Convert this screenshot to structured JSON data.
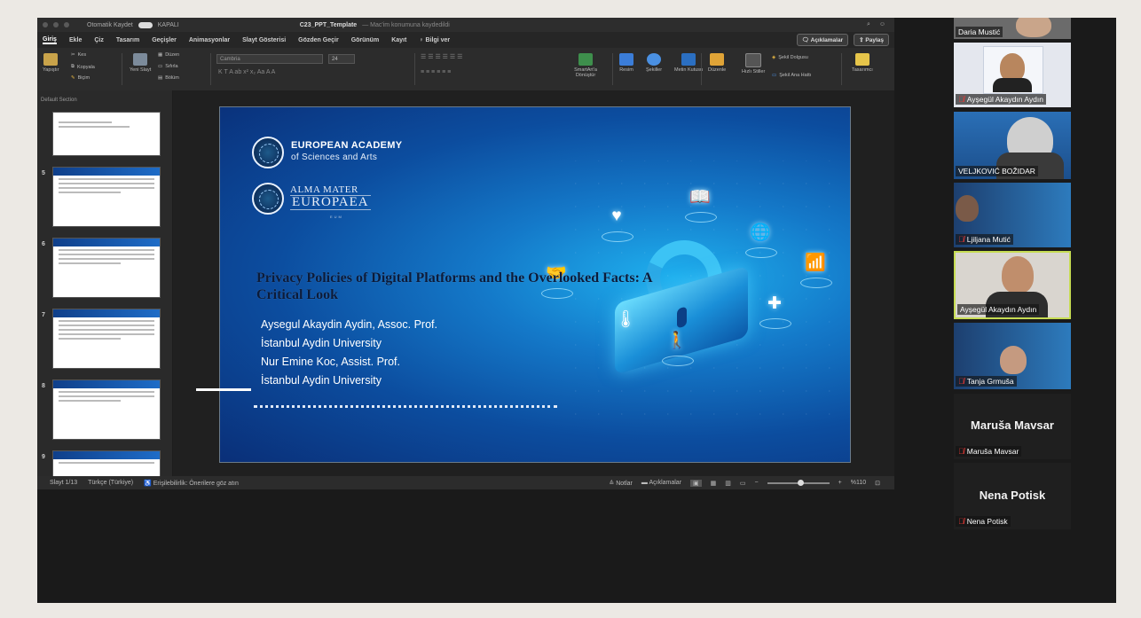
{
  "titlebar": {
    "autosave_label": "Otomatik Kaydet",
    "autosave_state": "KAPALI",
    "doc_title": "C23_PPT_Template",
    "doc_subtitle": "— Mac'im konumuna kaydedildi",
    "right_icons": "⌕ ☺"
  },
  "menu": {
    "tabs": [
      "Giriş",
      "Ekle",
      "Çiz",
      "Tasarım",
      "Geçişler",
      "Animasyonlar",
      "Slayt Gösterisi",
      "Gözden Geçir",
      "Görünüm",
      "Kayıt",
      "♀ Bilgi ver"
    ],
    "comments_button": "Açıklamalar",
    "share_button": "Paylaş"
  },
  "ribbon": {
    "paste": "Yapıştır",
    "cut": "Kes",
    "copy": "Kopyala",
    "format": "Biçim",
    "new_slide": "Yeni Slayt",
    "layout": "Düzen",
    "reset": "Sıfırla",
    "section": "Bölüm",
    "font_name": "Cambria",
    "font_size": "24",
    "format_row": "K  T  A  ab  x²  x₂  Aa  A  A",
    "smartart": "SmartArt'a Dönüştür",
    "picture": "Resim",
    "shapes": "Şekiller",
    "textbox": "Metin Kutusu",
    "arrange": "Düzenle",
    "quick_styles": "Hızlı Stiller",
    "shape_fill": "Şekil Dolgusu",
    "shape_outline": "Şekil Ana Hattı",
    "designer": "Tasarımcı"
  },
  "thumbnails": {
    "section_label": "Default Section",
    "slides": [
      {
        "num": ""
      },
      {
        "num": "5"
      },
      {
        "num": "6"
      },
      {
        "num": "7"
      },
      {
        "num": "8"
      },
      {
        "num": "9"
      }
    ]
  },
  "slide": {
    "academy_title": "EUROPEAN ACADEMY",
    "academy_subtitle": "of Sciences and Arts",
    "alma_title": "ALMA MATER",
    "alma_subtitle": "EUROPAEA",
    "alma_tiny": "EUM",
    "title": "Privacy Policies of Digital Platforms and the Overlooked Facts: A Critical Look",
    "authors": [
      "Aysegul Akaydin Aydin, Assoc. Prof.",
      "İstanbul Aydin University",
      "Nur Emine Koc, Assist. Prof.",
      "İstanbul Aydin University"
    ],
    "icons": [
      "heart-icon",
      "book-icon",
      "globe-icon",
      "chart-icon",
      "medical-icon",
      "handshake-icon",
      "thermometer-icon",
      "elderly-icon",
      "lock-icon"
    ]
  },
  "statusbar": {
    "slide_counter": "Slayt 1/13",
    "language": "Türkçe (Türkiye)",
    "accessibility": "Erişilebilirlik: Önerilere göz atın",
    "notes": "Notlar",
    "comments": "Açıklamalar",
    "zoom": "%110"
  },
  "participants": [
    {
      "name": "Daria Mustić",
      "muted": false
    },
    {
      "name": "Ayşegül Akaydın Aydın",
      "muted": true
    },
    {
      "name": "VELJKOVIĆ BOŽIDAR",
      "muted": false
    },
    {
      "name": "Ljiljana Mutić",
      "muted": true
    },
    {
      "name": "Ayşegül Akaydın Aydın",
      "muted": false,
      "active": true
    },
    {
      "name": "Tanja Grmuša",
      "muted": true
    },
    {
      "name": "Maruša Mavsar",
      "display": "Maruša Mavsar",
      "muted": true
    },
    {
      "name": "Nena Potisk",
      "display": "Nena Potisk",
      "muted": true
    }
  ],
  "colors": {
    "active_speaker_border": "#c6dc52",
    "slide_accent": "#1479c9",
    "muted_icon": "#e53935"
  }
}
